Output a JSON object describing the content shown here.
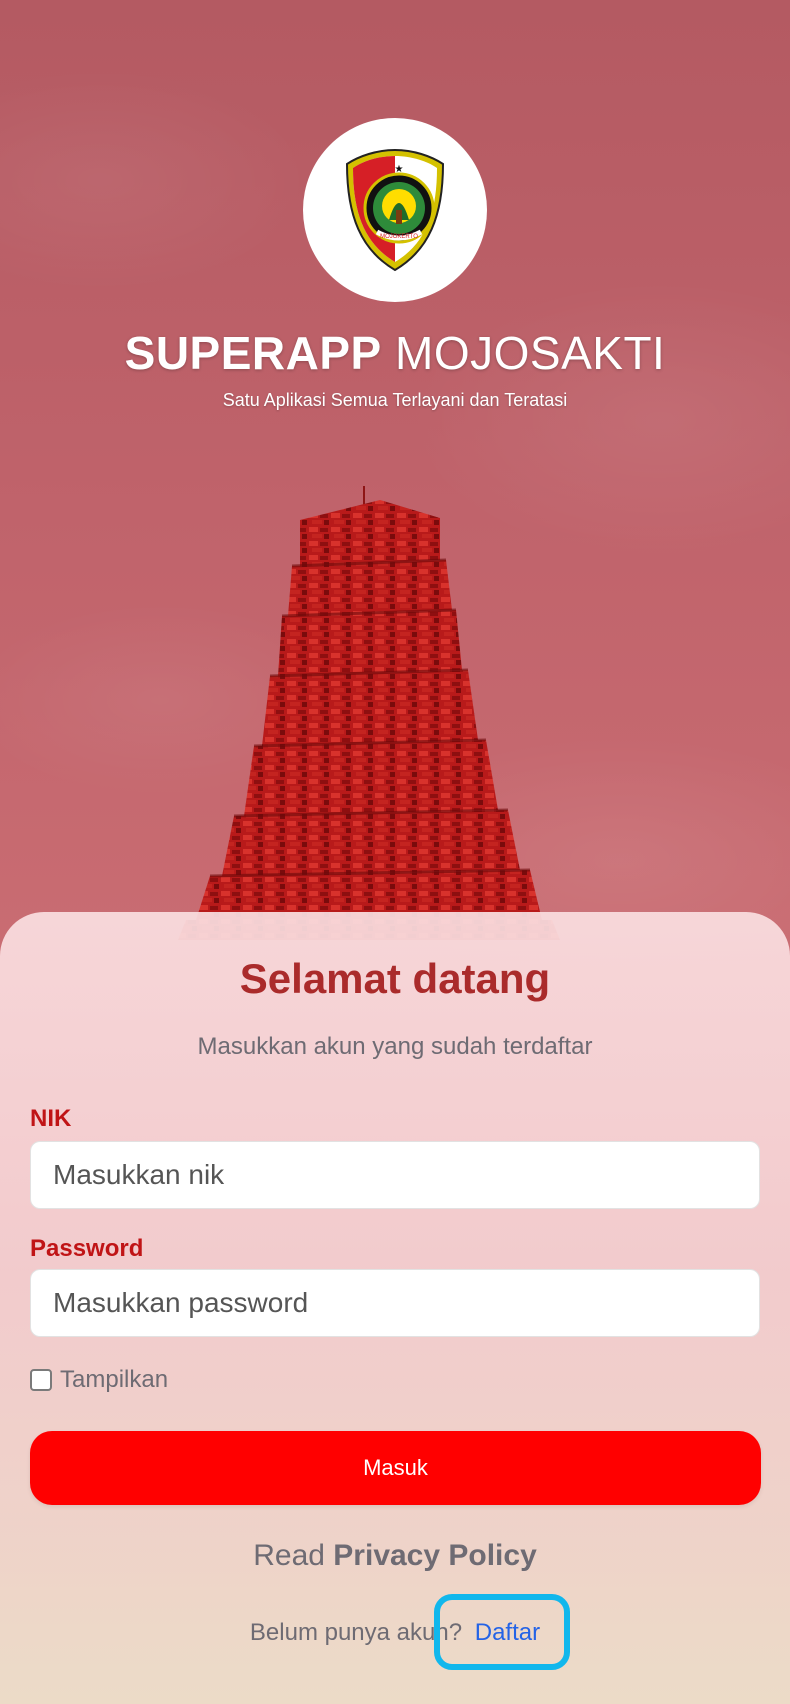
{
  "header": {
    "title_bold": "SUPERAPP",
    "title_light": "MOJOSAKTI",
    "tagline": "Satu Aplikasi Semua Terlayani dan Teratasi",
    "logo_icon": "mojokerto-emblem-icon",
    "logo_text": "MOJOKERTO"
  },
  "login": {
    "welcome": "Selamat datang",
    "subtitle": "Masukkan akun yang sudah terdaftar",
    "nik_label": "NIK",
    "nik_placeholder": "Masukkan nik",
    "password_label": "Password",
    "password_placeholder": "Masukkan password",
    "show_password_label": "Tampilkan",
    "show_password_checked": false,
    "submit_label": "Masuk",
    "privacy_prefix": "Read",
    "privacy_link": "Privacy Policy",
    "register_prompt": "Belum punya akun?",
    "register_link": "Daftar"
  },
  "colors": {
    "accent_red": "#ff0000",
    "heading_red": "#aa2b2b",
    "label_red": "#c01416",
    "link_blue": "#2463e6",
    "highlight_cyan": "#11b7ec"
  }
}
